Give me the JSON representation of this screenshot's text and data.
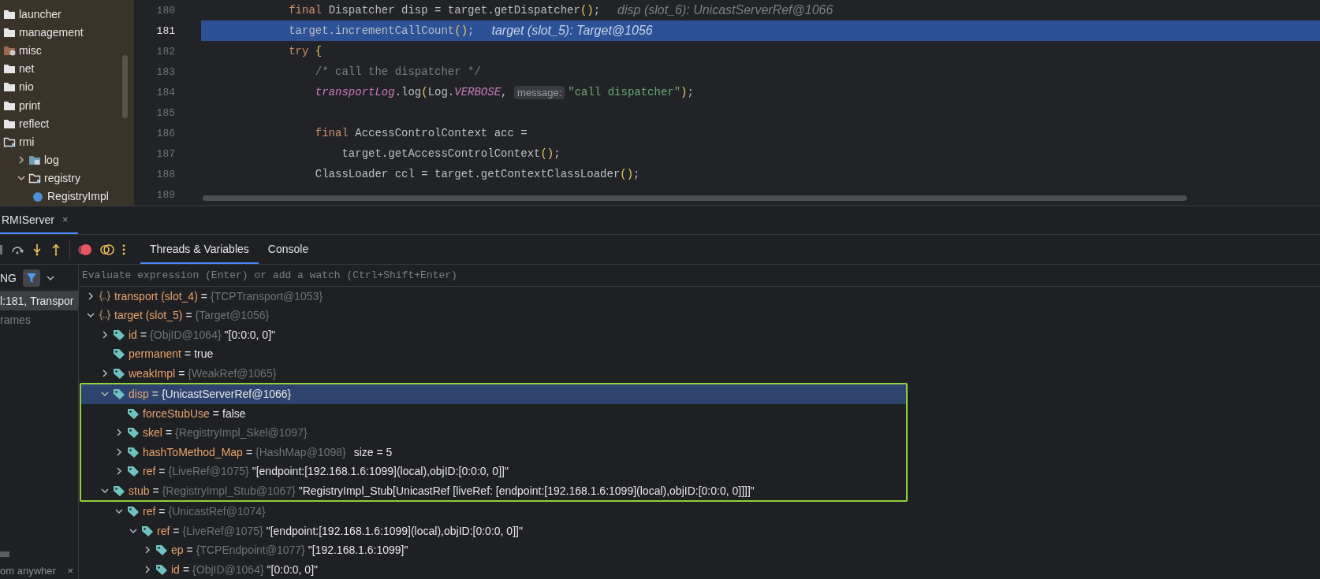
{
  "project_tree": [
    {
      "label": "launcher",
      "kind": "folder"
    },
    {
      "label": "management",
      "kind": "folder"
    },
    {
      "label": "misc",
      "kind": "special"
    },
    {
      "label": "net",
      "kind": "folder"
    },
    {
      "label": "nio",
      "kind": "folder"
    },
    {
      "label": "print",
      "kind": "folder"
    },
    {
      "label": "reflect",
      "kind": "folder"
    },
    {
      "label": "rmi",
      "kind": "package",
      "children": [
        {
          "label": "log",
          "kind": "module",
          "expanded": false
        },
        {
          "label": "registry",
          "kind": "package",
          "expanded": true,
          "children": [
            {
              "label": "RegistryImpl",
              "kind": "class"
            }
          ]
        }
      ]
    }
  ],
  "editor": {
    "lines": [
      {
        "number": "180",
        "selected": false,
        "tokens": [
          {
            "text": "        final ",
            "kind": "kw"
          },
          {
            "text": "Dispatcher disp = target.getDispatcher",
            "kind": "plain"
          },
          {
            "text": "()",
            "kind": "paren"
          },
          {
            "text": ";",
            "kind": "plain"
          },
          {
            "text": "disp (slot_6): UnicastServerRef@1066",
            "kind": "debug"
          }
        ]
      },
      {
        "number": "181",
        "selected": true,
        "tokens": [
          {
            "text": "        target.incrementCallCount",
            "kind": "plain"
          },
          {
            "text": "()",
            "kind": "paren"
          },
          {
            "text": ";",
            "kind": "plain"
          },
          {
            "text": "target (slot_5): Target@1056",
            "kind": "debug"
          }
        ]
      },
      {
        "number": "182",
        "selected": false,
        "tokens": [
          {
            "text": "        try ",
            "kind": "kw"
          },
          {
            "text": "{",
            "kind": "paren"
          }
        ]
      },
      {
        "number": "183",
        "selected": false,
        "tokens": [
          {
            "text": "            /* call the dispatcher */",
            "kind": "comment"
          }
        ]
      },
      {
        "number": "184",
        "selected": false,
        "tokens": [
          {
            "text": "            transportLog",
            "kind": "static"
          },
          {
            "text": ".log",
            "kind": "plain"
          },
          {
            "text": "(",
            "kind": "paren"
          },
          {
            "text": "Log.",
            "kind": "plain"
          },
          {
            "text": "VERBOSE",
            "kind": "static"
          },
          {
            "text": ", ",
            "kind": "plain"
          },
          {
            "text": "message:",
            "kind": "hint"
          },
          {
            "text": "\"call dispatcher\"",
            "kind": "str"
          },
          {
            "text": ")",
            "kind": "paren"
          },
          {
            "text": ";",
            "kind": "plain"
          }
        ]
      },
      {
        "number": "185",
        "selected": false
      },
      {
        "number": "186",
        "selected": false,
        "tokens": [
          {
            "text": "            final ",
            "kind": "kw"
          },
          {
            "text": "AccessControlContext acc =",
            "kind": "plain"
          }
        ]
      },
      {
        "number": "187",
        "selected": false,
        "tokens": [
          {
            "text": "                target.getAccessControlContext",
            "kind": "plain"
          },
          {
            "text": "()",
            "kind": "paren"
          },
          {
            "text": ";",
            "kind": "plain"
          }
        ]
      },
      {
        "number": "188",
        "selected": false,
        "tokens": [
          {
            "text": "            ClassLoader ccl = target.getContextClassLoader",
            "kind": "plain"
          },
          {
            "text": "()",
            "kind": "paren"
          },
          {
            "text": ";",
            "kind": "plain"
          }
        ]
      },
      {
        "number": "189",
        "selected": false
      }
    ]
  },
  "debug": {
    "session_tab": {
      "label": "RMIServer",
      "close": "×"
    },
    "tabs": [
      {
        "label": "Threads & Variables",
        "selected": true
      },
      {
        "label": "Console",
        "selected": false
      }
    ],
    "frames": {
      "header": "NG",
      "items": [
        {
          "text": "l:181, Transpor",
          "selected": true
        },
        {
          "text": "rames",
          "selected": false
        }
      ],
      "hint": "om anywher",
      "close": "×"
    },
    "evaluate_placeholder": "Evaluate expression (Enter) or add a watch (Ctrl+Shift+Enter)",
    "variables": [
      {
        "kind": "local",
        "name": "transport (slot_4)",
        "sign": "=",
        "type": "{TCPTransport@1053}",
        "expanded": false,
        "selected": false,
        "boxed": false
      },
      {
        "kind": "local",
        "name": "target (slot_5)",
        "sign": "=",
        "type": "{Target@1056}",
        "expanded": true,
        "selected": false,
        "boxed": false,
        "children": [
          {
            "kind": "field",
            "name": "id",
            "sign": "=",
            "type": "{ObjID@1064}",
            "value": "\"[0:0:0, 0]\"",
            "expanded": false,
            "selected": false,
            "boxed": false
          },
          {
            "kind": "field",
            "name": "permanent",
            "sign": "=",
            "value": "true",
            "selected": false,
            "boxed": false
          },
          {
            "kind": "field",
            "name": "weakImpl",
            "sign": "=",
            "type": "{WeakRef@1065}",
            "expanded": false,
            "selected": false,
            "boxed": false
          },
          {
            "kind": "field",
            "name": "disp",
            "sign": "=",
            "type": "{UnicastServerRef@1066}",
            "expanded": true,
            "selected": true,
            "boxed": true,
            "children": [
              {
                "kind": "field",
                "name": "forceStubUse",
                "sign": "=",
                "value": "false",
                "selected": false,
                "boxed": true
              },
              {
                "kind": "field",
                "name": "skel",
                "sign": "=",
                "type": "{RegistryImpl_Skel@1097}",
                "expanded": false,
                "selected": false,
                "boxed": true
              },
              {
                "kind": "field",
                "name": "hashToMethod_Map",
                "sign": "=",
                "type": "{HashMap@1098}",
                "extra": "size = 5",
                "expanded": false,
                "selected": false,
                "boxed": true
              },
              {
                "kind": "field",
                "name": "ref",
                "sign": "=",
                "type": "{LiveRef@1075}",
                "value": "\"[endpoint:[192.168.1.6:1099](local),objID:[0:0:0, 0]]\"",
                "expanded": false,
                "selected": false,
                "boxed": true
              }
            ]
          },
          {
            "kind": "field",
            "name": "stub",
            "sign": "=",
            "type": "{RegistryImpl_Stub@1067}",
            "value": "\"RegistryImpl_Stub[UnicastRef [liveRef: [endpoint:[192.168.1.6:1099](local),objID:[0:0:0, 0]]]]\"",
            "expanded": true,
            "selected": false,
            "boxed": true,
            "children": [
              {
                "kind": "field",
                "name": "ref",
                "sign": "=",
                "type": "{UnicastRef@1074}",
                "expanded": true,
                "selected": false,
                "boxed": false,
                "children": [
                  {
                    "kind": "field",
                    "name": "ref",
                    "sign": "=",
                    "type": "{LiveRef@1075}",
                    "value": "\"[endpoint:[192.168.1.6:1099](local),objID:[0:0:0, 0]]\"",
                    "expanded": true,
                    "selected": false,
                    "boxed": false,
                    "children": [
                      {
                        "kind": "field",
                        "name": "ep",
                        "sign": "=",
                        "type": "{TCPEndpoint@1077}",
                        "value": "\"[192.168.1.6:1099]\"",
                        "expanded": false,
                        "selected": false,
                        "boxed": false
                      },
                      {
                        "kind": "field",
                        "name": "id",
                        "sign": "=",
                        "type": "{ObjID@1064}",
                        "value": "\"[0:0:0, 0]\"",
                        "expanded": false,
                        "selected": false,
                        "boxed": false
                      }
                    ]
                  }
                ]
              }
            ]
          }
        ]
      }
    ]
  }
}
